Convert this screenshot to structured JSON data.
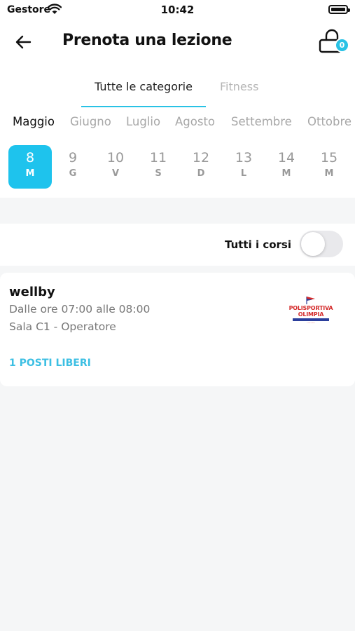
{
  "status_bar": {
    "carrier": "Gestore",
    "time": "10:42"
  },
  "header": {
    "title": "Prenota una lezione",
    "cart_count": "0"
  },
  "tabs": [
    {
      "label": "Tutte le categorie",
      "active": true
    },
    {
      "label": "Fitness",
      "active": false
    }
  ],
  "months": [
    "Maggio",
    "Giugno",
    "Luglio",
    "Agosto",
    "Settembre",
    "Ottobre"
  ],
  "days": [
    {
      "num": "8",
      "dow": "M",
      "active": true
    },
    {
      "num": "9",
      "dow": "G"
    },
    {
      "num": "10",
      "dow": "V"
    },
    {
      "num": "11",
      "dow": "S"
    },
    {
      "num": "12",
      "dow": "D"
    },
    {
      "num": "13",
      "dow": "L"
    },
    {
      "num": "14",
      "dow": "M"
    },
    {
      "num": "15",
      "dow": "M"
    }
  ],
  "filter": {
    "label": "Tutti i corsi",
    "enabled": false
  },
  "lesson": {
    "name": "wellby",
    "time": "Dalle ore 07:00 alle 08:00",
    "room": "Sala C1 - Operatore",
    "seats": "1 POSTI LIBERI",
    "logo_line1": "POLISPORTIVA",
    "logo_line2": "OLIMPIA"
  },
  "colors": {
    "accent": "#1ec3ed",
    "seats_text": "#3cbfe3",
    "logo_red": "#d42a2a",
    "logo_blue": "#2b3f9c"
  }
}
